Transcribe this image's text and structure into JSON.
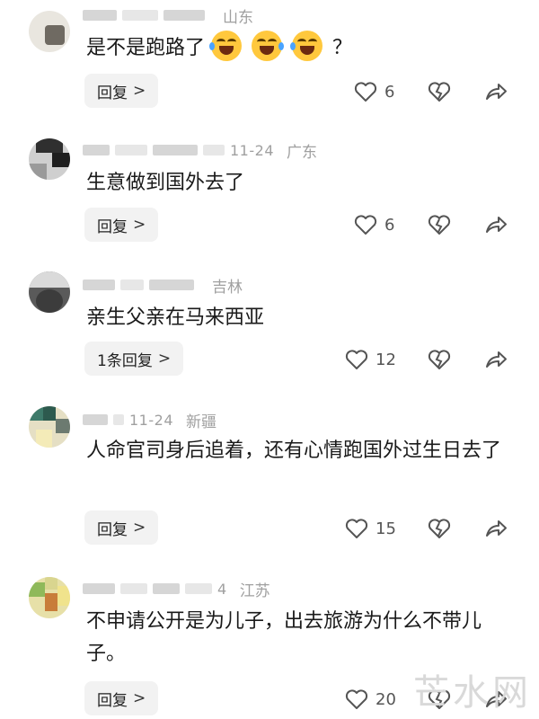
{
  "comments": [
    {
      "date": "",
      "region": "山东",
      "text": "是不是跑路了",
      "text_suffix": "？",
      "emoji_count": 3,
      "emoji_name": "laugh-cry-emoji",
      "reply": "回复",
      "likes": "6"
    },
    {
      "date": "11-24",
      "region": "广东",
      "text": "生意做到国外去了",
      "reply": "回复",
      "likes": "6"
    },
    {
      "date": "",
      "region": "吉林",
      "text": "亲生父亲在马来西亚",
      "reply": "1条回复",
      "likes": "12"
    },
    {
      "date": "11-24",
      "region": "新疆",
      "text": "人命官司身后追着，还有心情跑国外过生日去了",
      "reply": "回复",
      "likes": "15"
    },
    {
      "date": "4",
      "region": "江苏",
      "text": "不申请公开是为儿子，出去旅游为什么不带儿子。",
      "reply": "回复",
      "likes": "20"
    }
  ],
  "icons": {
    "like": "heart-outline-icon",
    "dislike": "broken-heart-icon",
    "share": "share-arrow-icon",
    "chevron": "chevron-right-icon"
  },
  "colors": {
    "meta": "#a0a0a0",
    "reply_bg": "#f2f2f2"
  },
  "watermark": "芒水网"
}
